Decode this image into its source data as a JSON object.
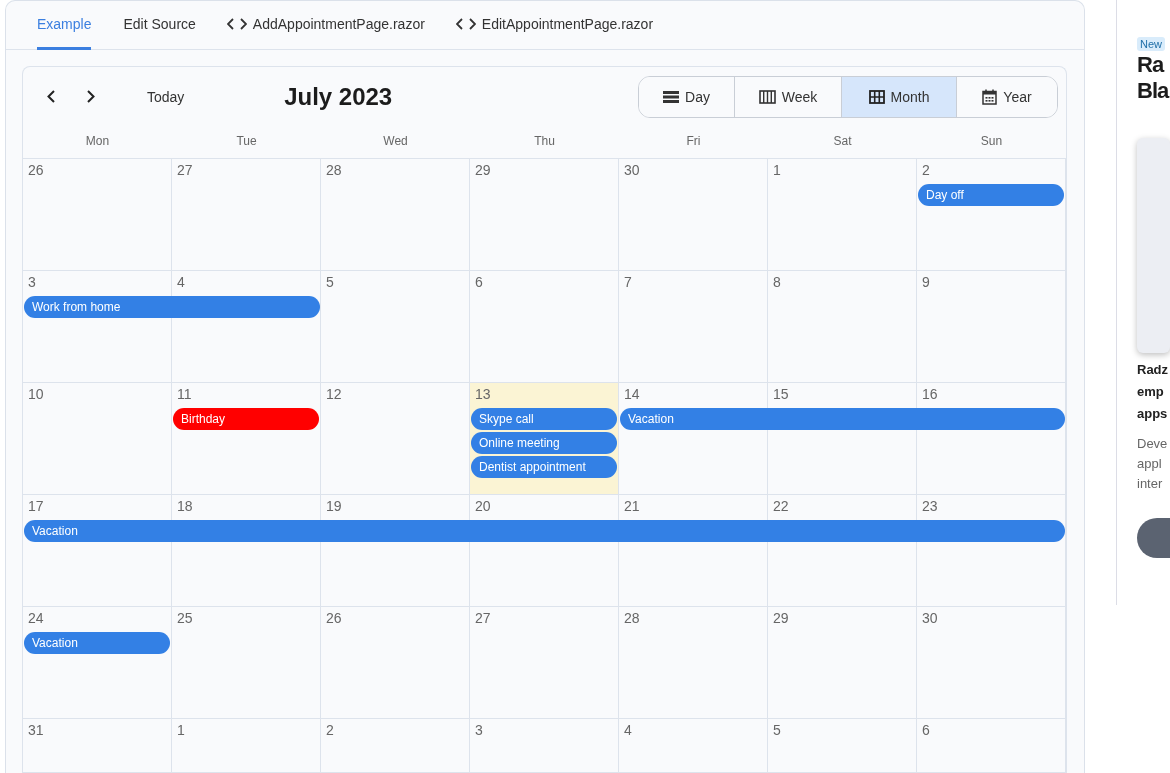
{
  "tabs": [
    {
      "label": "Example",
      "kind": "plain",
      "selected": true
    },
    {
      "label": "Edit Source",
      "kind": "plain",
      "selected": false
    },
    {
      "label": "AddAppointmentPage.razor",
      "kind": "file",
      "selected": false
    },
    {
      "label": "EditAppointmentPage.razor",
      "kind": "file",
      "selected": false
    }
  ],
  "calendar": {
    "today_button": "Today",
    "title": "July 2023",
    "views": [
      {
        "label": "Day",
        "kind": "day",
        "selected": false
      },
      {
        "label": "Week",
        "kind": "week",
        "selected": false
      },
      {
        "label": "Month",
        "kind": "month",
        "selected": true
      },
      {
        "label": "Year",
        "kind": "year",
        "selected": false
      }
    ],
    "weekdays": [
      "Mon",
      "Tue",
      "Wed",
      "Thu",
      "Fri",
      "Sat",
      "Sun"
    ],
    "weeks": [
      {
        "days": [
          {
            "label": "26",
            "today": false
          },
          {
            "label": "27",
            "today": false
          },
          {
            "label": "28",
            "today": false
          },
          {
            "label": "29",
            "today": false
          },
          {
            "label": "30",
            "today": false
          },
          {
            "label": "1",
            "today": false
          },
          {
            "label": "2",
            "today": false,
            "events": [
              {
                "kind": "start",
                "title": "Day off",
                "color": "#3380e5"
              }
            ]
          }
        ]
      },
      {
        "days": [
          {
            "label": "3",
            "today": false,
            "events": [
              {
                "kind": "start",
                "title": "Work from home",
                "color": "#3380e5"
              }
            ]
          },
          {
            "label": "4",
            "today": false,
            "events": [
              {
                "kind": "continuation"
              }
            ]
          },
          {
            "label": "5",
            "today": false
          },
          {
            "label": "6",
            "today": false
          },
          {
            "label": "7",
            "today": false
          },
          {
            "label": "8",
            "today": false
          },
          {
            "label": "9",
            "today": false
          }
        ]
      },
      {
        "days": [
          {
            "label": "10",
            "today": false
          },
          {
            "label": "11",
            "today": false,
            "events": [
              {
                "kind": "start",
                "title": "Birthday",
                "color": "#ff0000"
              }
            ]
          },
          {
            "label": "12",
            "today": false
          },
          {
            "label": "13",
            "today": true,
            "events": [
              {
                "kind": "start",
                "title": "Skype call",
                "color": "#3380e5"
              },
              {
                "kind": "start",
                "title": "Online meeting",
                "color": "#3380e5"
              },
              {
                "kind": "start",
                "title": "Dentist appointment",
                "color": "#3380e5"
              }
            ]
          },
          {
            "label": "14",
            "today": false,
            "events": [
              {
                "kind": "start",
                "title": "Vacation",
                "color": "#3380e5"
              }
            ]
          },
          {
            "label": "15",
            "today": false,
            "events": [
              {
                "kind": "continuation"
              }
            ]
          },
          {
            "label": "16",
            "today": false,
            "events": [
              {
                "kind": "continuation"
              }
            ]
          }
        ]
      },
      {
        "days": [
          {
            "label": "17",
            "today": false,
            "events": [
              {
                "kind": "start",
                "title": "Vacation",
                "color": "#3380e5"
              }
            ]
          },
          {
            "label": "18",
            "today": false,
            "events": [
              {
                "kind": "continuation"
              }
            ]
          },
          {
            "label": "19",
            "today": false,
            "events": [
              {
                "kind": "continuation"
              }
            ]
          },
          {
            "label": "20",
            "today": false,
            "events": [
              {
                "kind": "continuation"
              }
            ]
          },
          {
            "label": "21",
            "today": false,
            "events": [
              {
                "kind": "continuation"
              }
            ]
          },
          {
            "label": "22",
            "today": false,
            "events": [
              {
                "kind": "continuation"
              }
            ]
          },
          {
            "label": "23",
            "today": false,
            "events": [
              {
                "kind": "continuation"
              }
            ]
          }
        ]
      },
      {
        "days": [
          {
            "label": "24",
            "today": false,
            "events": [
              {
                "kind": "start",
                "title": "Vacation",
                "color": "#3380e5"
              }
            ]
          },
          {
            "label": "25",
            "today": false
          },
          {
            "label": "26",
            "today": false
          },
          {
            "label": "27",
            "today": false
          },
          {
            "label": "28",
            "today": false
          },
          {
            "label": "29",
            "today": false
          },
          {
            "label": "30",
            "today": false
          }
        ]
      },
      {
        "days": [
          {
            "label": "31",
            "today": false
          },
          {
            "label": "1",
            "today": false
          },
          {
            "label": "2",
            "today": false
          },
          {
            "label": "3",
            "today": false
          },
          {
            "label": "4",
            "today": false
          },
          {
            "label": "5",
            "today": false
          },
          {
            "label": "6",
            "today": false
          }
        ]
      }
    ]
  },
  "sidebar": {
    "badge": "New",
    "title_lines": [
      "Ra",
      "Bla"
    ],
    "lead_lines": [
      "Radz",
      "emp",
      "apps"
    ],
    "body_lines": [
      "Deve",
      "appl",
      "inter"
    ]
  }
}
